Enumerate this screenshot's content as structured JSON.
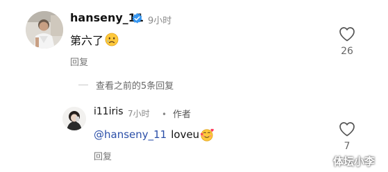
{
  "top_comment": {
    "username": "hanseny_11",
    "verified": true,
    "time": "9小时",
    "text": "第六了",
    "emoji": "sad-face-emoji",
    "reply_label": "回复",
    "like_count": "26"
  },
  "view_previous": {
    "label": "查看之前的5条回复"
  },
  "reply_comment": {
    "username": "i11iris",
    "time": "7小时",
    "separator": "•",
    "author_tag": "作者",
    "mention": "@hanseny_11",
    "text": "loveu",
    "emoji": "heart-face-emoji",
    "reply_label": "回复",
    "like_count": "7"
  },
  "watermark": "体坛小李",
  "colors": {
    "verified_blue": "#3897f0",
    "mention_blue": "#2b4fa8",
    "muted_text": "#888888"
  }
}
